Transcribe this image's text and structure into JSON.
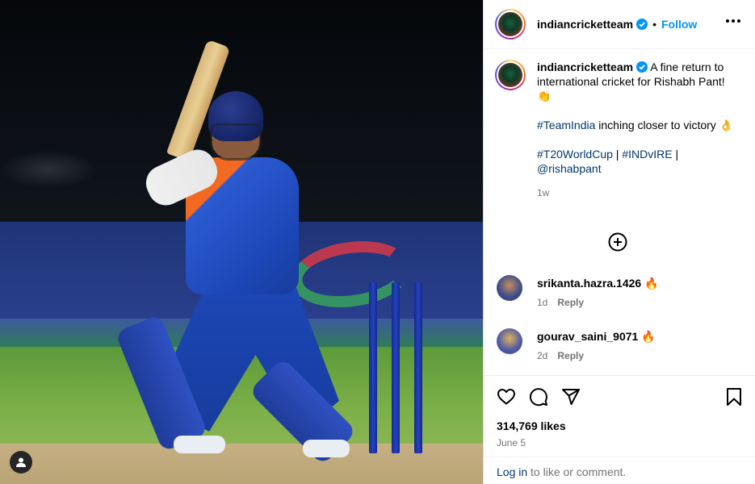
{
  "account": {
    "username": "indiancricketteam",
    "follow_label": "Follow",
    "separator": "•"
  },
  "caption": {
    "username": "indiancricketteam",
    "line1": "A fine return to international cricket for Rishabh Pant! 👏",
    "line2_tag": "#TeamIndia",
    "line2_text": " inching closer to victory 👌",
    "tags": [
      "#T20WorldCup",
      "#INDvIRE"
    ],
    "separator": " | ",
    "mention": "@rishabpant",
    "time": "1w"
  },
  "comments": [
    {
      "username": "srikanta.hazra.1426",
      "text": "🔥",
      "time": "1d",
      "reply_label": "Reply",
      "avatar_color": "#3a4a8a"
    },
    {
      "username": "gourav_saini_9071",
      "text": "🔥",
      "time": "2d",
      "reply_label": "Reply",
      "avatar_color": "#4a57a8"
    }
  ],
  "actions": {
    "likes": "314,769 likes",
    "date": "June 5"
  },
  "login": {
    "link": "Log in",
    "text": " to like or comment."
  },
  "colors": {
    "accent": "#0095f6",
    "verified": "#0095f6",
    "hashtag": "#00376b"
  },
  "icons": [
    "more-icon",
    "verified-icon",
    "add-circle-icon",
    "heart-icon",
    "comment-icon",
    "share-icon",
    "bookmark-icon",
    "user-tag-icon"
  ]
}
